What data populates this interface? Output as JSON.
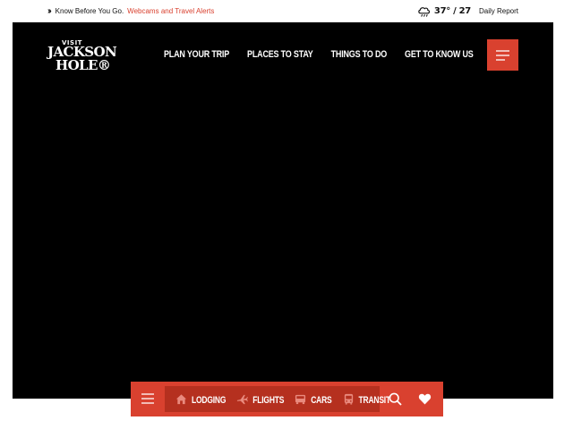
{
  "alert": {
    "lead": "Know Before You Go.",
    "link": "Webcams and Travel Alerts"
  },
  "weather": {
    "icon": "rain-cloud-icon",
    "temps": "37° / 27",
    "report": "Daily Report"
  },
  "logo": {
    "line1": "VISIT",
    "line2": "JACKSON",
    "line3": "HOLE®"
  },
  "nav": {
    "items": [
      "PLAN YOUR TRIP",
      "PLACES TO STAY",
      "THINGS TO DO",
      "GET TO KNOW US"
    ]
  },
  "actionbar": {
    "items": [
      {
        "label": "LODGING",
        "icon": "house-icon"
      },
      {
        "label": "FLIGHTS",
        "icon": "plane-icon"
      },
      {
        "label": "CARS",
        "icon": "car-icon"
      },
      {
        "label": "TRANSIT",
        "icon": "bus-icon"
      }
    ]
  },
  "colors": {
    "accent": "#d9412f",
    "accent_dark": "#b5301f",
    "hero_bg": "#000000"
  }
}
